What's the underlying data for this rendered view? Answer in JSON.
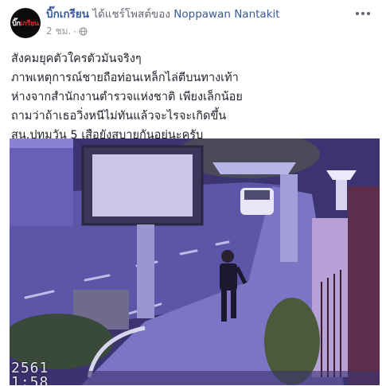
{
  "post": {
    "page_name": "บิ๊กเกรียน",
    "shared_text": "ได้แชร์โพสต์ของ",
    "original_author": "Noppawan Nantakit",
    "time": "2 ชม.",
    "time_separator": "·",
    "privacy_icon": "globe-icon",
    "more_icon": "more-options-icon",
    "text_lines": [
      "สังคมยุคตัวใครตัวมันจริงๆ",
      "ภาพเหตุการณ์ชายถือท่อนเหล็กไล่ตีบนทางเท้า",
      "ห่างจากสำนักงานตำรวจแห่งชาติ เพียงเล็กน้อย",
      "ถามว่าถ้าเธอวิ่งหนีไม่ทันแล้วจะไรจะเกิดขึ้น",
      "สน.ปทุมวัน 5 เสือยังสบายกันอยู่นะครับ"
    ]
  },
  "avatar": {
    "logo_text_white": "บิ๊ก",
    "logo_text_red": "เกรียน"
  },
  "photo": {
    "description_role": "cctv-footage",
    "timestamp_line1": "2561",
    "timestamp_line2": "1:58"
  },
  "colors": {
    "link_blue": "#365899",
    "meta_gray": "#90949c",
    "text_dark": "#1d2129"
  }
}
